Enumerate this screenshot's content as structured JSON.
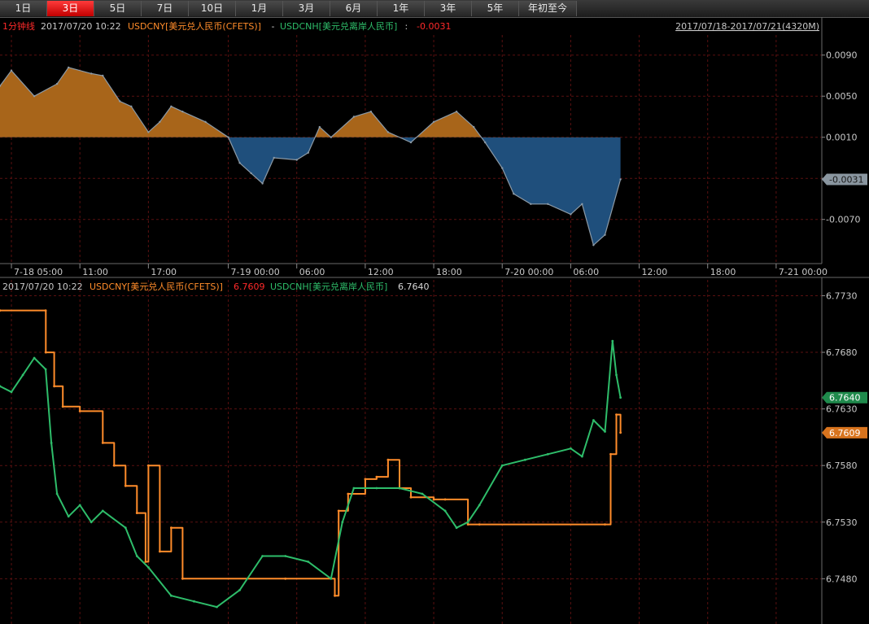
{
  "tabs": [
    {
      "label": "1日"
    },
    {
      "label": "3日",
      "active": true
    },
    {
      "label": "5日"
    },
    {
      "label": "7日"
    },
    {
      "label": "10日"
    },
    {
      "label": "1月"
    },
    {
      "label": "3月"
    },
    {
      "label": "6月"
    },
    {
      "label": "1年"
    },
    {
      "label": "3年"
    },
    {
      "label": "5年"
    },
    {
      "label": "年初至今"
    }
  ],
  "colors": {
    "accent_red": "#ff2a2a",
    "cny": "#ff8c2a",
    "cnh": "#2ebd6a",
    "spread_pos_fill": "#a8651a",
    "spread_neg_fill": "#1f4f7c",
    "spread_line": "#8c9aa6",
    "grid": "#5a1010",
    "text": "#c8c8c8"
  },
  "top_panel": {
    "legend": {
      "period": "1分钟线",
      "datetime": "2017/07/20 10:22",
      "label_a": "USDCNY[美元兑人民币(CFETS)]",
      "sep": " - ",
      "label_b": "USDCNH[美元兑离岸人民币]",
      "colon": " : ",
      "value": "-0.0031"
    },
    "range_label": "2017/07/18-2017/07/21(4320M)",
    "y_ticks": [
      "0.0090",
      "0.0050",
      "0.0010",
      "-0.0030",
      "-0.0070"
    ],
    "current_tag": "-0.0031",
    "x_ticks": [
      "7-18 05:00",
      "11:00",
      "17:00",
      "7-19 00:00",
      "06:00",
      "12:00",
      "18:00",
      "7-20 00:00",
      "06:00",
      "12:00",
      "18:00",
      "7-21 00:00"
    ]
  },
  "bottom_panel": {
    "legend": {
      "datetime": "2017/07/20 10:22",
      "cny_label": "USDCNY[美元兑人民币(CFETS)]",
      "cny_value": "6.7609",
      "cnh_label": "USDCNH[美元兑离岸人民币]",
      "cnh_value": "6.7640"
    },
    "y_ticks": [
      "6.7730",
      "6.7680",
      "6.7630",
      "6.7580",
      "6.7530",
      "6.7480"
    ],
    "tag_cnh": "6.7640",
    "tag_cny": "6.7609"
  },
  "chart_data": [
    {
      "type": "area",
      "title": "USDCNY[美元兑人民币(CFETS)] - USDCNH[美元兑离岸人民币]",
      "x_label_format": "time",
      "xlim": [
        "2017-07-18 04:00",
        "2017-07-21 04:00"
      ],
      "ylim": [
        -0.0113,
        0.0127
      ],
      "baseline": 0.001,
      "x": [
        "2017-07-18 04:00",
        "2017-07-18 05:00",
        "2017-07-18 07:00",
        "2017-07-18 09:00",
        "2017-07-18 10:00",
        "2017-07-18 12:00",
        "2017-07-18 13:00",
        "2017-07-18 14:30",
        "2017-07-18 15:30",
        "2017-07-18 17:00",
        "2017-07-18 18:00",
        "2017-07-18 19:00",
        "2017-07-18 20:00",
        "2017-07-18 22:00",
        "2017-07-19 00:00",
        "2017-07-19 01:00",
        "2017-07-19 02:00",
        "2017-07-19 03:00",
        "2017-07-19 04:00",
        "2017-07-19 06:00",
        "2017-07-19 07:00",
        "2017-07-19 08:00",
        "2017-07-19 09:00",
        "2017-07-19 11:00",
        "2017-07-19 12:30",
        "2017-07-19 14:00",
        "2017-07-19 16:00",
        "2017-07-19 18:00",
        "2017-07-19 20:00",
        "2017-07-19 21:30",
        "2017-07-19 22:30",
        "2017-07-20 00:00",
        "2017-07-20 01:00",
        "2017-07-20 02:30",
        "2017-07-20 04:00",
        "2017-07-20 06:00",
        "2017-07-20 07:00",
        "2017-07-20 08:00",
        "2017-07-20 09:00",
        "2017-07-20 10:22"
      ],
      "series": [
        {
          "values": [
            0.006,
            0.0075,
            0.005,
            0.0062,
            0.0078,
            0.0072,
            0.007,
            0.0045,
            0.004,
            0.0015,
            0.0025,
            0.004,
            0.0035,
            0.0025,
            0.001,
            -0.0015,
            -0.0025,
            -0.0035,
            -0.001,
            -0.0012,
            -0.0005,
            0.002,
            0.001,
            0.003,
            0.0035,
            0.0015,
            0.0005,
            0.0025,
            0.0035,
            0.002,
            0.0005,
            -0.002,
            -0.0045,
            -0.0055,
            -0.0055,
            -0.0065,
            -0.0055,
            -0.0095,
            -0.0085,
            -0.0031
          ]
        }
      ]
    },
    {
      "type": "line",
      "title": "",
      "xlim": [
        "2017-07-18 04:00",
        "2017-07-21 04:00"
      ],
      "ylim": [
        6.744,
        6.7744
      ],
      "series": [
        {
          "name": "USDCNY[美元兑人民币(CFETS)]",
          "x": [
            "2017-07-18 04:00",
            "2017-07-18 08:00",
            "2017-07-18 08:01",
            "2017-07-18 08:45",
            "2017-07-18 09:30",
            "2017-07-18 11:00",
            "2017-07-18 13:00",
            "2017-07-18 14:00",
            "2017-07-18 15:00",
            "2017-07-18 16:00",
            "2017-07-18 16:45",
            "2017-07-18 17:00",
            "2017-07-18 18:00",
            "2017-07-18 19:00",
            "2017-07-18 20:00",
            "2017-07-19 05:00",
            "2017-07-19 09:20",
            "2017-07-19 09:40",
            "2017-07-19 10:30",
            "2017-07-19 12:00",
            "2017-07-19 13:00",
            "2017-07-19 14:00",
            "2017-07-19 15:00",
            "2017-07-19 16:00",
            "2017-07-19 18:00",
            "2017-07-19 19:00",
            "2017-07-19 21:00",
            "2017-07-19 22:00",
            "2017-07-20 09:00",
            "2017-07-20 09:30",
            "2017-07-20 10:00",
            "2017-07-20 10:22"
          ],
          "values": [
            6.7717,
            6.7717,
            6.768,
            6.765,
            6.7632,
            6.7628,
            6.76,
            6.758,
            6.7562,
            6.7538,
            6.7495,
            6.758,
            6.7504,
            6.7525,
            6.748,
            6.748,
            6.7465,
            6.754,
            6.7555,
            6.7568,
            6.757,
            6.7585,
            6.756,
            6.7552,
            6.755,
            6.755,
            6.7528,
            6.7528,
            6.7528,
            6.759,
            6.7625,
            6.7609
          ]
        },
        {
          "name": "USDCNH[美元兑离岸人民币]",
          "x": [
            "2017-07-18 04:00",
            "2017-07-18 05:00",
            "2017-07-18 06:00",
            "2017-07-18 07:00",
            "2017-07-18 08:00",
            "2017-07-18 08:30",
            "2017-07-18 09:00",
            "2017-07-18 10:00",
            "2017-07-18 11:00",
            "2017-07-18 12:00",
            "2017-07-18 13:00",
            "2017-07-18 15:00",
            "2017-07-18 16:00",
            "2017-07-18 17:00",
            "2017-07-18 19:00",
            "2017-07-18 21:00",
            "2017-07-18 23:00",
            "2017-07-19 01:00",
            "2017-07-19 03:00",
            "2017-07-19 05:00",
            "2017-07-19 07:00",
            "2017-07-19 09:00",
            "2017-07-19 10:00",
            "2017-07-19 11:00",
            "2017-07-19 13:00",
            "2017-07-19 15:00",
            "2017-07-19 17:00",
            "2017-07-19 19:00",
            "2017-07-19 20:00",
            "2017-07-19 21:00",
            "2017-07-19 22:00",
            "2017-07-20 00:00",
            "2017-07-20 02:00",
            "2017-07-20 04:00",
            "2017-07-20 06:00",
            "2017-07-20 07:00",
            "2017-07-20 08:00",
            "2017-07-20 09:00",
            "2017-07-20 09:40",
            "2017-07-20 10:00",
            "2017-07-20 10:22"
          ],
          "values": [
            6.765,
            6.7645,
            6.766,
            6.7675,
            6.7665,
            6.76,
            6.7555,
            6.7535,
            6.7545,
            6.753,
            6.754,
            6.7525,
            6.75,
            6.749,
            6.7465,
            6.746,
            6.7455,
            6.747,
            6.75,
            6.75,
            6.7495,
            6.748,
            6.753,
            6.756,
            6.756,
            6.756,
            6.7555,
            6.754,
            6.7525,
            6.753,
            6.7545,
            6.758,
            6.7585,
            6.759,
            6.7595,
            6.7588,
            6.762,
            6.761,
            6.769,
            6.766,
            6.764
          ]
        }
      ]
    }
  ]
}
